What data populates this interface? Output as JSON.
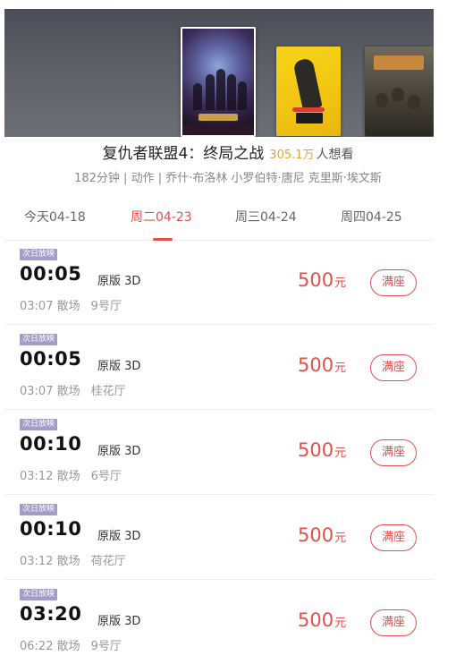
{
  "movie": {
    "title": "复仇者联盟4：终局之战",
    "want_count": "305.1万",
    "want_label": "人想看",
    "meta": "182分钟 | 动作 | 乔什·布洛林 小罗伯特·唐尼 克里斯·埃文斯"
  },
  "posters": [
    {
      "name": "avengers-endgame-poster",
      "selected": true
    },
    {
      "name": "yellow-movie-poster",
      "selected": false
    },
    {
      "name": "dark-movie-poster",
      "selected": false
    }
  ],
  "date_tabs": [
    {
      "label": "今天04-18",
      "active": false
    },
    {
      "label": "周二04-23",
      "active": true
    },
    {
      "label": "周三04-24",
      "active": false
    },
    {
      "label": "周四04-25",
      "active": false
    }
  ],
  "showtimes": [
    {
      "badge": "次日放映",
      "start": "00:05",
      "version": "原版 3D",
      "end": "03:07 散场",
      "hall": "9号厅",
      "price": "500",
      "unit": "元",
      "button": "满座"
    },
    {
      "badge": "次日放映",
      "start": "00:05",
      "version": "原版 3D",
      "end": "03:07 散场",
      "hall": "桂花厅",
      "price": "500",
      "unit": "元",
      "button": "满座"
    },
    {
      "badge": "次日放映",
      "start": "00:10",
      "version": "原版 3D",
      "end": "03:12 散场",
      "hall": "6号厅",
      "price": "500",
      "unit": "元",
      "button": "满座"
    },
    {
      "badge": "次日放映",
      "start": "00:10",
      "version": "原版 3D",
      "end": "03:12 散场",
      "hall": "荷花厅",
      "price": "500",
      "unit": "元",
      "button": "满座"
    },
    {
      "badge": "次日放映",
      "start": "03:20",
      "version": "原版 3D",
      "end": "06:22 散场",
      "hall": "9号厅",
      "price": "500",
      "unit": "元",
      "button": "满座"
    }
  ],
  "colors": {
    "accent": "#e3504a",
    "want": "#e5a43b",
    "badge": "#a59bc7"
  }
}
